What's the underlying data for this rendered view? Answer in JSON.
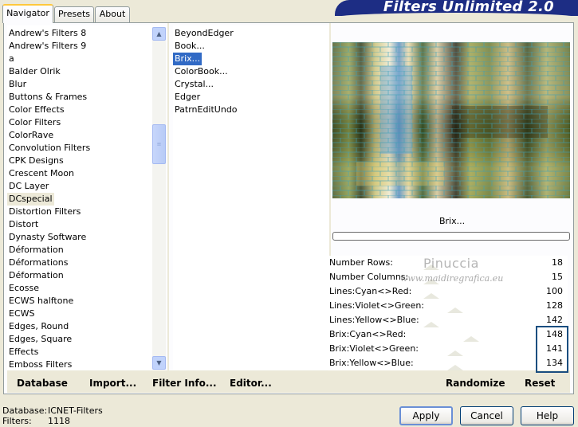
{
  "tabs": [
    {
      "label": "Navigator",
      "active": true
    },
    {
      "label": "Presets",
      "active": false
    },
    {
      "label": "About",
      "active": false
    }
  ],
  "banner": {
    "title": "Filters Unlimited 2.0",
    "color": "#1d2d84"
  },
  "categories": [
    "Andrew's Filters 8",
    "Andrew's Filters 9",
    "a",
    "Balder Olrik",
    "Blur",
    "Buttons & Frames",
    "Color Effects",
    "Color Filters",
    "ColorRave",
    "Convolution Filters",
    "CPK Designs",
    "Crescent Moon",
    "DC Layer",
    "DCspecial",
    "Distortion Filters",
    "Distort",
    "Dynasty Software",
    "Déformation",
    "Déformations",
    "Déformation",
    "Ecosse",
    "ECWS halftone",
    "ECWS",
    "Edges, Round",
    "Edges, Square",
    "Effects",
    "Emboss Filters"
  ],
  "selected_category": "DCspecial",
  "filters": [
    "BeyondEdger",
    "Book...",
    "Brix...",
    "ColorBook...",
    "Crystal...",
    "Edger",
    "PatrnEditUndo"
  ],
  "selected_filter": "Brix...",
  "current_filter_title": "Brix...",
  "params": [
    {
      "label": "Number Rows:",
      "value": "18"
    },
    {
      "label": "Number Columns:",
      "value": "15"
    },
    {
      "label": "Lines:Cyan<>Red:",
      "value": "100"
    },
    {
      "label": "Lines:Violet<>Green:",
      "value": "128"
    },
    {
      "label": "Lines:Yellow<>Blue:",
      "value": "142"
    },
    {
      "label": "Brix:Cyan<>Red:",
      "value": "148"
    },
    {
      "label": "Brix:Violet<>Green:",
      "value": "141"
    },
    {
      "label": "Brix:Yellow<>Blue:",
      "value": "134"
    }
  ],
  "watermark": {
    "line1": "Pinuccia",
    "line2": "www.maidiregrafica.eu"
  },
  "bottom_links": {
    "database": "Database",
    "import": "Import...",
    "filter_info": "Filter Info...",
    "editor": "Editor...",
    "randomize": "Randomize",
    "reset": "Reset"
  },
  "status": {
    "database_label": "Database:",
    "database_value": "ICNET-Filters",
    "filters_label": "Filters:",
    "filters_value": "1118"
  },
  "buttons": {
    "apply": "Apply",
    "cancel": "Cancel",
    "help": "Help"
  },
  "icons": {
    "scroll_up": "chevron-up-icon",
    "scroll_down": "chevron-down-icon",
    "thumb_grip": "grip-icon"
  },
  "colors": {
    "selection": "#316ac5",
    "highlight_box": "#1a4e80",
    "dialog_bg": "#ece9d8"
  }
}
